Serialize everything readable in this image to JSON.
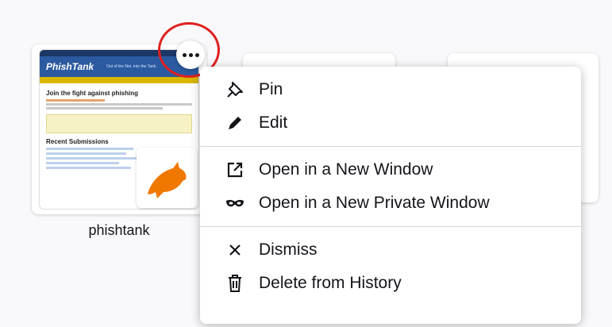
{
  "tiles": [
    {
      "label": "phishtank",
      "thumbnail": {
        "logo_text": "PhishTank",
        "tagline": "Out of the Net, into the Tank.",
        "heading": "Join the fight against phishing",
        "recent_heading": "Recent Submissions"
      }
    }
  ],
  "context_menu": {
    "groups": [
      [
        {
          "label": "Pin",
          "icon": "pin-icon"
        },
        {
          "label": "Edit",
          "icon": "pencil-icon"
        }
      ],
      [
        {
          "label": "Open in a New Window",
          "icon": "open-new-window-icon"
        },
        {
          "label": "Open in a New Private Window",
          "icon": "private-mask-icon"
        }
      ],
      [
        {
          "label": "Dismiss",
          "icon": "close-x-icon"
        },
        {
          "label": "Delete from History",
          "icon": "trash-icon"
        }
      ]
    ]
  },
  "colors": {
    "highlight_ring": "#e02020",
    "badge_fish": "#f07800",
    "phishtank_header": "#2b5aa0"
  }
}
